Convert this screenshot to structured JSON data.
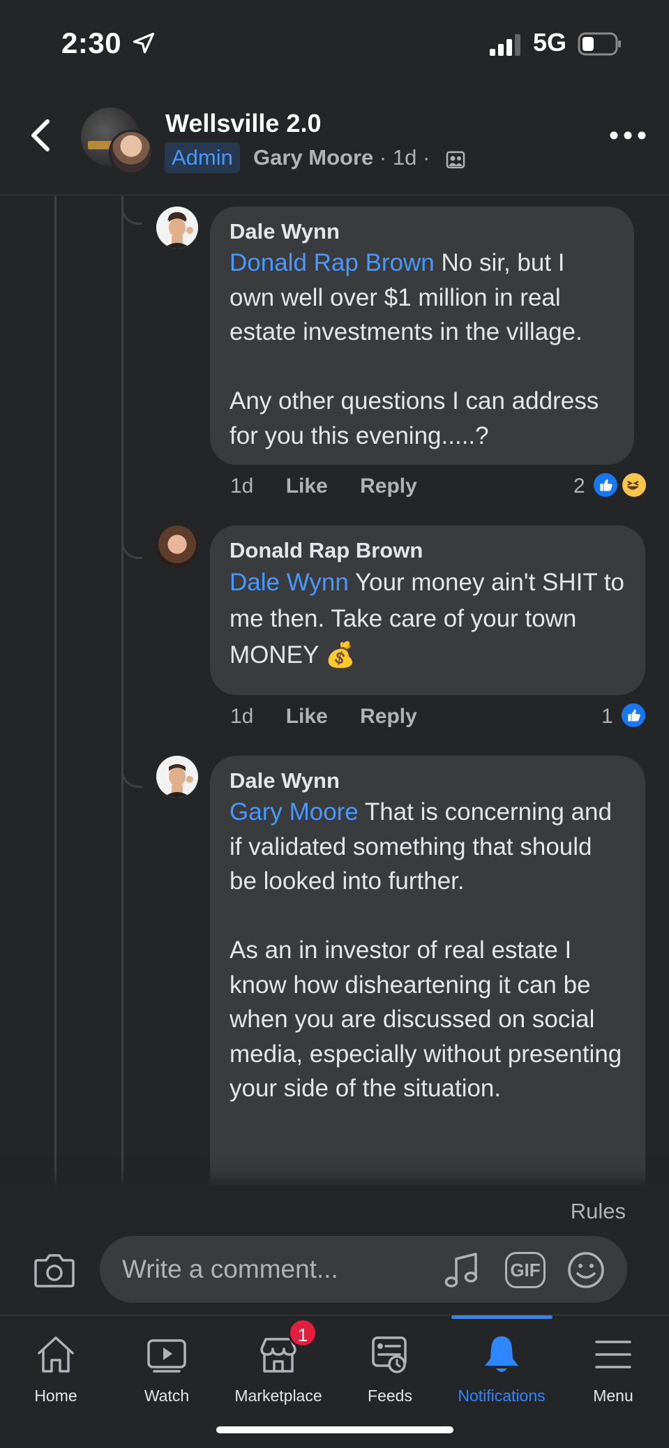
{
  "status_bar": {
    "time": "2:30",
    "network": "5G"
  },
  "header": {
    "group_name": "Wellsville 2.0",
    "badge": "Admin",
    "author": "Gary Moore",
    "timestamp": "1d",
    "separator": "·"
  },
  "comments": [
    {
      "author": "Dale Wynn",
      "mention": "Donald Rap Brown",
      "text": " No sir, but I own well over $1 million in real estate investments in the village.\n\nAny other questions I can address for you this evening.....?",
      "time": "1d",
      "like_label": "Like",
      "reply_label": "Reply",
      "reaction_count": "2",
      "reactions": [
        "like-icon",
        "haha-icon"
      ]
    },
    {
      "author": "Donald Rap Brown",
      "mention": "Dale Wynn",
      "text": " Your money ain't SHIT to me then. Take care of your town MONEY 💰",
      "time": "1d",
      "like_label": "Like",
      "reply_label": "Reply",
      "reaction_count": "1",
      "reactions": [
        "like-icon"
      ]
    },
    {
      "author": "Dale Wynn",
      "mention": "Gary Moore",
      "text": " That is concerning and if validated something that should be looked into further.\n\nAs an in investor of real estate I know how disheartening it can be when you are discussed on social media, especially without presenting your side of the situation."
    }
  ],
  "composer": {
    "rules_label": "Rules",
    "placeholder": "Write a comment...",
    "gif_label": "GIF"
  },
  "bottom_nav": {
    "items": [
      {
        "label": "Home",
        "icon": "home-icon"
      },
      {
        "label": "Watch",
        "icon": "watch-icon"
      },
      {
        "label": "Marketplace",
        "icon": "marketplace-icon",
        "badge": "1"
      },
      {
        "label": "Feeds",
        "icon": "feeds-icon"
      },
      {
        "label": "Notifications",
        "icon": "bell-icon",
        "active": true
      },
      {
        "label": "Menu",
        "icon": "menu-icon"
      }
    ]
  },
  "colors": {
    "background": "#242526",
    "bubble": "#3a3b3c",
    "accent": "#2d88ff",
    "mention": "#4599ff",
    "badge": "#e41e3f"
  }
}
